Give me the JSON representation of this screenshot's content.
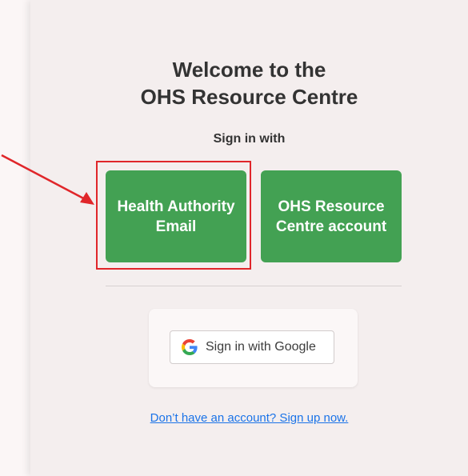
{
  "welcome": {
    "line1": "Welcome to the",
    "line2": "OHS Resource Centre"
  },
  "signin_with_label": "Sign in with",
  "buttons": {
    "health_authority": {
      "line1": "Health Authority",
      "line2": "Email"
    },
    "ohs_account": {
      "line1": "OHS Resource",
      "line2": "Centre account"
    }
  },
  "google": {
    "label": "Sign in with Google",
    "icon": "google-g-icon"
  },
  "signup_link": "Don’t have an account? Sign up now.",
  "annotation": {
    "highlight_color": "#e0262a",
    "arrow_color": "#e0262a"
  },
  "colors": {
    "button_green": "#43a153",
    "panel_bg": "#f4eeee",
    "link_blue": "#1a73e8"
  }
}
